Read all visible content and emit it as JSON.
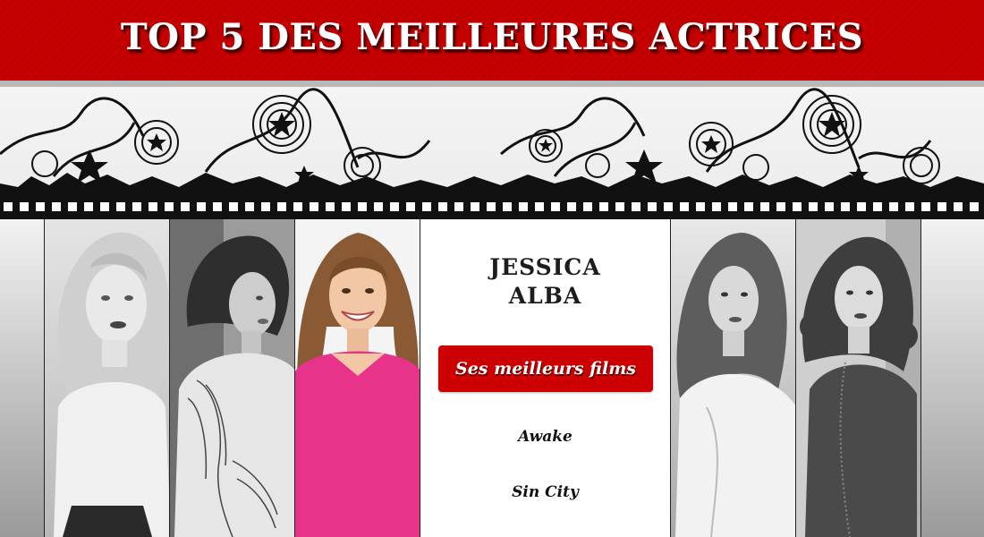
{
  "header": {
    "title": "TOP 5 DES MEILLEURES ACTRICES"
  },
  "colors": {
    "header_red": "#c70000",
    "button_red": "#cc0000",
    "panel_bg": "#ffffff",
    "text_dark": "#1d1d1d"
  },
  "banner": {
    "decoration": "film-strip-stars-swirls"
  },
  "gallery": {
    "portraits": [
      {
        "icon": "portrait-blonde-woman",
        "tone": "grayscale"
      },
      {
        "icon": "portrait-short-hair-woman-wing-tattoo",
        "tone": "grayscale"
      },
      {
        "icon": "portrait-smiling-woman-pink-top",
        "tone": "color"
      },
      {
        "icon": "portrait-wavy-hair-woman",
        "tone": "grayscale"
      },
      {
        "icon": "portrait-curly-hair-woman",
        "tone": "grayscale"
      }
    ]
  },
  "panel": {
    "name_line1": "JESSICA",
    "name_line2": "ALBA",
    "button_label": "Ses meilleurs films",
    "films": [
      "Awake",
      "Sin City"
    ]
  }
}
